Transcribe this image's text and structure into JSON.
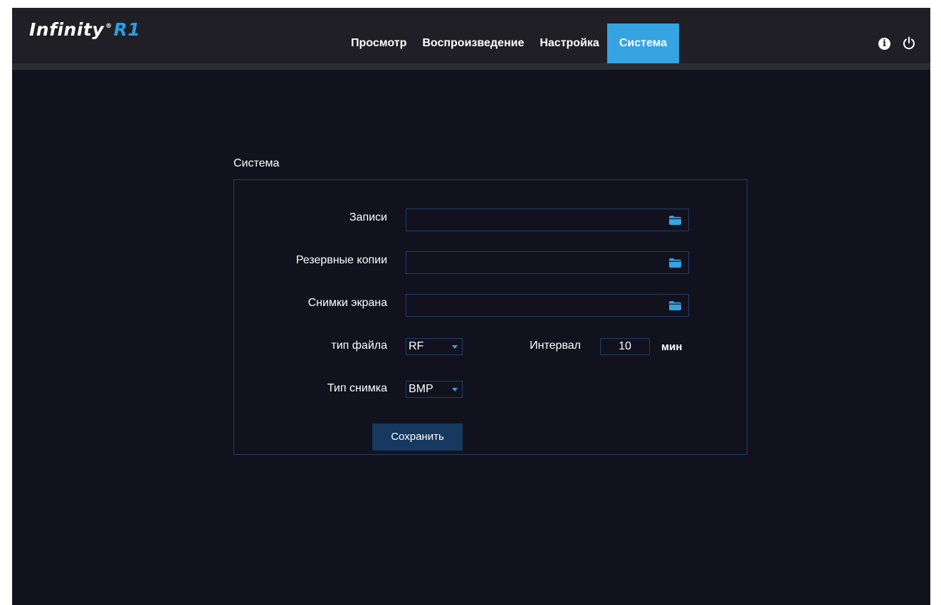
{
  "header": {
    "logo_text": "Infinity",
    "logo_accent": "R1",
    "tabs": [
      {
        "label": "Просмотр",
        "active": false
      },
      {
        "label": "Воспроизведение",
        "active": false
      },
      {
        "label": "Настройка",
        "active": false
      },
      {
        "label": "Система",
        "active": true
      }
    ],
    "icons": [
      "info-icon",
      "power-icon"
    ]
  },
  "section": {
    "title": "Система"
  },
  "form": {
    "records_label": "Записи",
    "records_value": "",
    "backups_label": "Резервные копии",
    "backups_value": "",
    "snapshots_label": "Снимки экрана",
    "snapshots_value": "",
    "file_type_label": "тип файла",
    "file_type_value": "RF",
    "interval_label": "Интервал",
    "interval_value": "10",
    "interval_unit": "мин",
    "snapshot_type_label": "Тип снимка",
    "snapshot_type_value": "BMP",
    "save_label": "Сохранить"
  },
  "colors": {
    "background": "#12121f",
    "topbar": "#1f1f25",
    "accent": "#36a3e2",
    "border": "#1f3e66",
    "button": "#17385f"
  }
}
